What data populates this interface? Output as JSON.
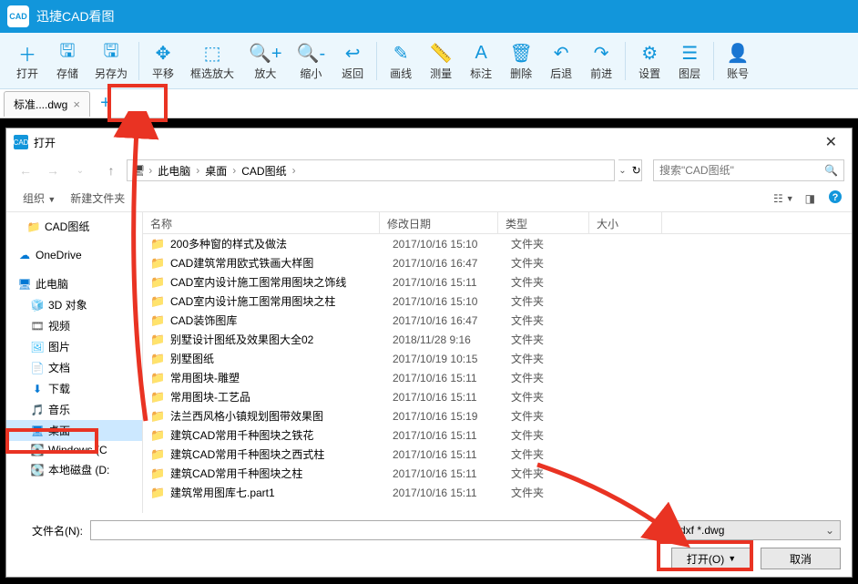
{
  "app": {
    "title": "迅捷CAD看图",
    "logo_text": "CAD"
  },
  "toolbar": [
    {
      "icon": "＋",
      "label": "打开"
    },
    {
      "icon": "🖫",
      "label": "存储"
    },
    {
      "icon": "🖫",
      "label": "另存为"
    },
    {
      "sep": true
    },
    {
      "icon": "✥",
      "label": "平移"
    },
    {
      "icon": "⬚",
      "label": "框选放大"
    },
    {
      "icon": "🔍+",
      "label": "放大"
    },
    {
      "icon": "🔍-",
      "label": "缩小"
    },
    {
      "icon": "↩",
      "label": "返回"
    },
    {
      "sep": true
    },
    {
      "icon": "✎",
      "label": "画线"
    },
    {
      "icon": "📏",
      "label": "测量"
    },
    {
      "icon": "A",
      "label": "标注"
    },
    {
      "icon": "🗑",
      "label": "删除"
    },
    {
      "icon": "↶",
      "label": "后退"
    },
    {
      "icon": "↷",
      "label": "前进"
    },
    {
      "sep": true
    },
    {
      "icon": "⚙",
      "label": "设置"
    },
    {
      "icon": "☰",
      "label": "图层"
    },
    {
      "sep": true
    },
    {
      "icon": "👤",
      "label": "账号"
    }
  ],
  "tabs": {
    "active": "标准....dwg",
    "new_tab": "+"
  },
  "dialog": {
    "title": "打开",
    "logo": "CAD",
    "breadcrumb": [
      "此电脑",
      "桌面",
      "CAD图纸"
    ],
    "search_placeholder": "搜索\"CAD图纸\"",
    "organize": "组织",
    "new_folder": "新建文件夹",
    "nav_tree": [
      {
        "label": "CAD图纸",
        "icon": "📁",
        "indent": 18
      },
      {
        "label": "OneDrive",
        "icon": "☁",
        "indent": 8,
        "color": "#0078d4",
        "gap_before": true
      },
      {
        "label": "此电脑",
        "icon": "🖥",
        "indent": 8,
        "color": "#0078d4",
        "gap_before": true
      },
      {
        "label": "3D 对象",
        "icon": "🧊",
        "indent": 22,
        "color": "#38bdf8"
      },
      {
        "label": "视频",
        "icon": "🎞",
        "indent": 22,
        "color": "#555"
      },
      {
        "label": "图片",
        "icon": "🖼",
        "indent": 22,
        "color": "#38bdf8"
      },
      {
        "label": "文档",
        "icon": "📄",
        "indent": 22,
        "color": "#555"
      },
      {
        "label": "下载",
        "icon": "⬇",
        "indent": 22,
        "color": "#0078d4"
      },
      {
        "label": "音乐",
        "icon": "🎵",
        "indent": 22,
        "color": "#0078d4"
      },
      {
        "label": "桌面",
        "icon": "🖥",
        "indent": 22,
        "color": "#0078d4",
        "selected": true
      },
      {
        "label": "Windows (C",
        "icon": "💽",
        "indent": 22,
        "color": "#888"
      },
      {
        "label": "本地磁盘 (D:",
        "icon": "💽",
        "indent": 22,
        "color": "#888"
      }
    ],
    "columns": {
      "name": "名称",
      "date": "修改日期",
      "type": "类型",
      "size": "大小"
    },
    "files": [
      {
        "name": "200多种窗的样式及做法",
        "date": "2017/10/16 15:10",
        "type": "文件夹"
      },
      {
        "name": "CAD建筑常用欧式铁画大样图",
        "date": "2017/10/16 16:47",
        "type": "文件夹"
      },
      {
        "name": "CAD室内设计施工图常用图块之饰线",
        "date": "2017/10/16 15:11",
        "type": "文件夹"
      },
      {
        "name": "CAD室内设计施工图常用图块之柱",
        "date": "2017/10/16 15:10",
        "type": "文件夹"
      },
      {
        "name": "CAD装饰图库",
        "date": "2017/10/16 16:47",
        "type": "文件夹"
      },
      {
        "name": "别墅设计图纸及效果图大全02",
        "date": "2018/11/28 9:16",
        "type": "文件夹"
      },
      {
        "name": "别墅图纸",
        "date": "2017/10/19 10:15",
        "type": "文件夹"
      },
      {
        "name": "常用图块-雕塑",
        "date": "2017/10/16 15:11",
        "type": "文件夹"
      },
      {
        "name": "常用图块-工艺品",
        "date": "2017/10/16 15:11",
        "type": "文件夹"
      },
      {
        "name": "法兰西风格小镇规划图带效果图",
        "date": "2017/10/16 15:19",
        "type": "文件夹"
      },
      {
        "name": "建筑CAD常用千种图块之铁花",
        "date": "2017/10/16 15:11",
        "type": "文件夹"
      },
      {
        "name": "建筑CAD常用千种图块之西式柱",
        "date": "2017/10/16 15:11",
        "type": "文件夹"
      },
      {
        "name": "建筑CAD常用千种图块之柱",
        "date": "2017/10/16 15:11",
        "type": "文件夹"
      },
      {
        "name": "建筑常用图库七.part1",
        "date": "2017/10/16 15:11",
        "type": "文件夹"
      }
    ],
    "filename_label": "文件名(N):",
    "filter": "*.dxf *.dwg",
    "open_button": "打开(O)",
    "cancel_button": "取消"
  }
}
